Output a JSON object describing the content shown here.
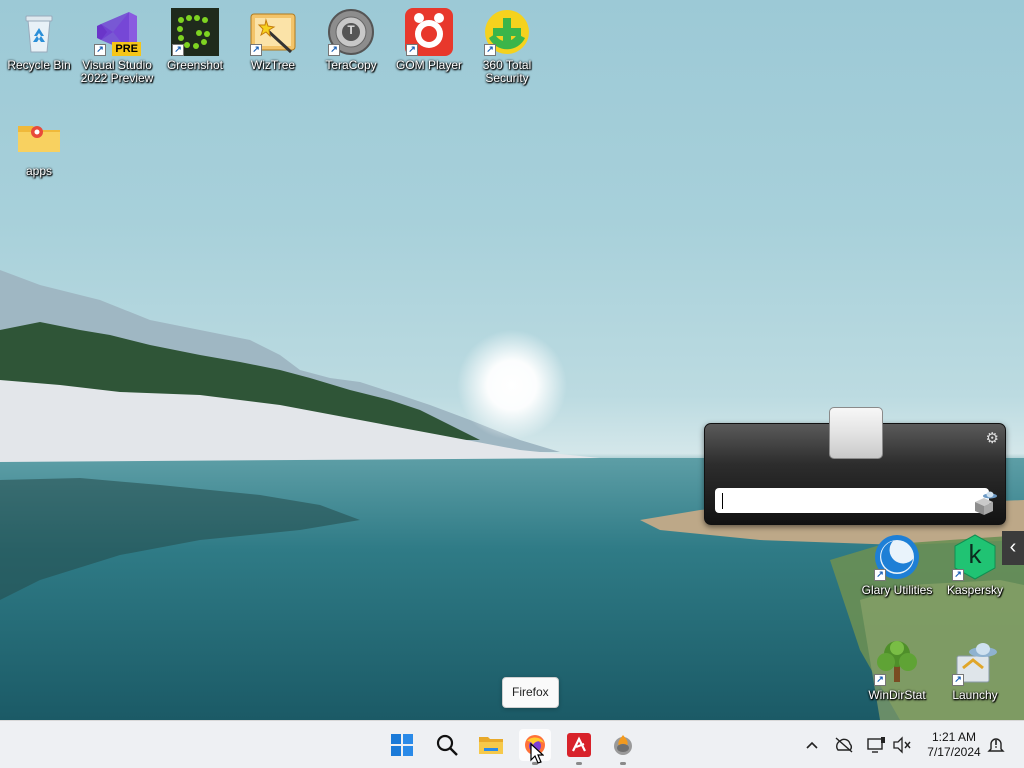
{
  "desktop_icons": [
    {
      "id": "recycle-bin",
      "label": "Recycle Bin"
    },
    {
      "id": "visual-studio",
      "label": "Visual Studio 2022 Preview",
      "badge": "PRE"
    },
    {
      "id": "greenshot",
      "label": "Greenshot"
    },
    {
      "id": "wiztree",
      "label": "WizTree"
    },
    {
      "id": "teracopy",
      "label": "TeraCopy",
      "glyph": "T"
    },
    {
      "id": "gom-player",
      "label": "GOM Player"
    },
    {
      "id": "360-total-security",
      "label": "360 Total Security"
    },
    {
      "id": "apps-folder",
      "label": "apps"
    },
    {
      "id": "glary-utilities",
      "label": "Glary Utilities"
    },
    {
      "id": "kaspersky",
      "label": "Kaspersky",
      "glyph": "k"
    },
    {
      "id": "windirstat",
      "label": "WinDirStat"
    },
    {
      "id": "launchy",
      "label": "Launchy"
    }
  ],
  "launchy": {
    "input_value": "",
    "gear_icon": "gear-icon",
    "side_arrow": "‹"
  },
  "tooltip": {
    "text": "Firefox"
  },
  "taskbar": {
    "apps": [
      {
        "id": "start",
        "icon": "windows-start-icon"
      },
      {
        "id": "search",
        "icon": "search-icon"
      },
      {
        "id": "file-explorer",
        "icon": "folder-icon"
      },
      {
        "id": "firefox",
        "icon": "firefox-icon",
        "active": true
      },
      {
        "id": "avira",
        "icon": "avira-icon"
      },
      {
        "id": "app-6",
        "icon": "globe-fire-icon"
      }
    ],
    "tray": [
      "chevron-up-icon",
      "network-off-icon",
      "monitor-icon",
      "volume-muted-icon"
    ],
    "time": "1:21 AM",
    "date": "7/17/2024",
    "notifications_icon": "bell-icon"
  },
  "colors": {
    "taskbar_bg": "#eef0f3",
    "firefox_orange": "#ff7139",
    "avira_red": "#d8222a"
  }
}
